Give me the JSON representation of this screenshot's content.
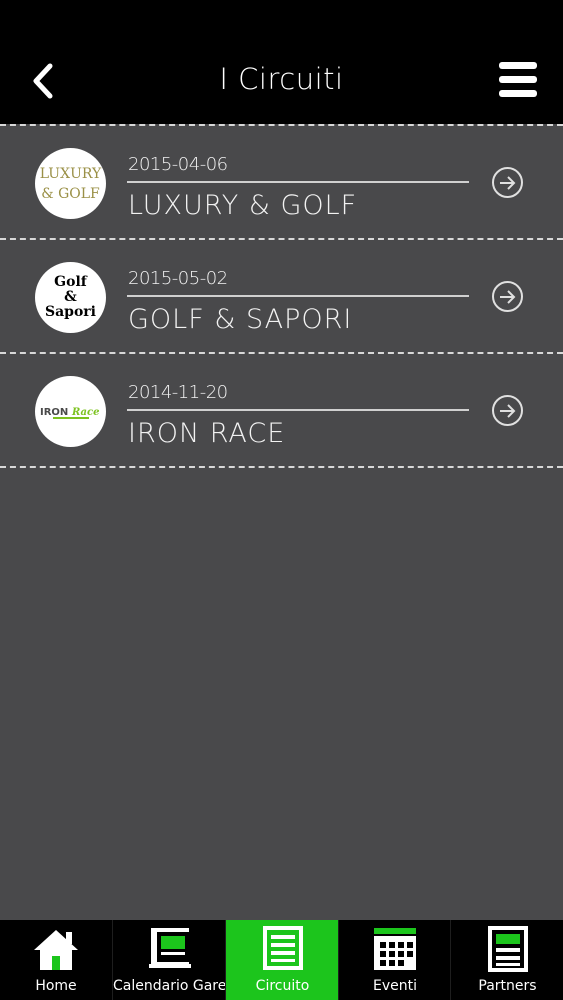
{
  "header": {
    "title": "I Circuiti",
    "back_icon": "chevron-left-icon",
    "menu_icon": "hamburger-menu-icon"
  },
  "circuits": [
    {
      "date": "2015-04-06",
      "name": "LUXURY & GOLF",
      "logo_text": [
        "LUXURY",
        "& GOLF"
      ]
    },
    {
      "date": "2015-05-02",
      "name": "GOLF & SAPORI",
      "logo_text": [
        "Golf",
        "&",
        "Sapori"
      ]
    },
    {
      "date": "2014-11-20",
      "name": "IRON RACE",
      "logo_text": [
        "IRON",
        "Race"
      ]
    }
  ],
  "tabs": [
    {
      "label": "Home",
      "icon": "house-icon"
    },
    {
      "label": "Calendario Gare",
      "icon": "calendar-book-icon"
    },
    {
      "label": "Circuito",
      "icon": "document-icon"
    },
    {
      "label": "Eventi",
      "icon": "calendar-grid-icon"
    },
    {
      "label": "Partners",
      "icon": "partners-doc-icon"
    }
  ],
  "colors": {
    "accent": "#1cc51c",
    "background": "#49494b",
    "bar": "#000000"
  }
}
